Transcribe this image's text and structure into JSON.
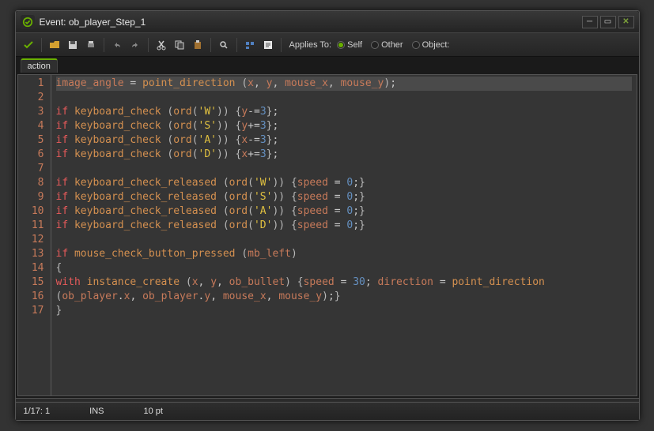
{
  "window": {
    "title": "Event: ob_player_Step_1"
  },
  "toolbar": {
    "applies_to_label": "Applies To:",
    "radios": {
      "self": "Self",
      "other": "Other",
      "object": "Object:"
    }
  },
  "tab": {
    "label": "action"
  },
  "code": {
    "lines": [
      {
        "n": 1,
        "tokens": [
          [
            "var",
            "image_angle"
          ],
          [
            "op",
            " = "
          ],
          [
            "fn",
            "point_direction"
          ],
          [
            "op",
            " "
          ],
          [
            "paren",
            "("
          ],
          [
            "var",
            "x"
          ],
          [
            "op",
            ", "
          ],
          [
            "var",
            "y"
          ],
          [
            "op",
            ", "
          ],
          [
            "var",
            "mouse_x"
          ],
          [
            "op",
            ", "
          ],
          [
            "var",
            "mouse_y"
          ],
          [
            "paren",
            ")"
          ],
          [
            "op",
            ";"
          ]
        ],
        "hl": true
      },
      {
        "n": 2,
        "tokens": []
      },
      {
        "n": 3,
        "tokens": [
          [
            "kw",
            "if"
          ],
          [
            "op",
            " "
          ],
          [
            "fn",
            "keyboard_check"
          ],
          [
            "op",
            " "
          ],
          [
            "paren",
            "("
          ],
          [
            "fn",
            "ord"
          ],
          [
            "paren",
            "("
          ],
          [
            "str",
            "'W'"
          ],
          [
            "paren",
            ")"
          ],
          [
            "paren",
            ")"
          ],
          [
            "op",
            " "
          ],
          [
            "paren",
            "{"
          ],
          [
            "var",
            "y"
          ],
          [
            "op",
            "-="
          ],
          [
            "num",
            "3"
          ],
          [
            "paren",
            "}"
          ],
          [
            "op",
            ";"
          ]
        ]
      },
      {
        "n": 4,
        "tokens": [
          [
            "kw",
            "if"
          ],
          [
            "op",
            " "
          ],
          [
            "fn",
            "keyboard_check"
          ],
          [
            "op",
            " "
          ],
          [
            "paren",
            "("
          ],
          [
            "fn",
            "ord"
          ],
          [
            "paren",
            "("
          ],
          [
            "str",
            "'S'"
          ],
          [
            "paren",
            ")"
          ],
          [
            "paren",
            ")"
          ],
          [
            "op",
            " "
          ],
          [
            "paren",
            "{"
          ],
          [
            "var",
            "y"
          ],
          [
            "op",
            "+="
          ],
          [
            "num",
            "3"
          ],
          [
            "paren",
            "}"
          ],
          [
            "op",
            ";"
          ]
        ]
      },
      {
        "n": 5,
        "tokens": [
          [
            "kw",
            "if"
          ],
          [
            "op",
            " "
          ],
          [
            "fn",
            "keyboard_check"
          ],
          [
            "op",
            " "
          ],
          [
            "paren",
            "("
          ],
          [
            "fn",
            "ord"
          ],
          [
            "paren",
            "("
          ],
          [
            "str",
            "'A'"
          ],
          [
            "paren",
            ")"
          ],
          [
            "paren",
            ")"
          ],
          [
            "op",
            " "
          ],
          [
            "paren",
            "{"
          ],
          [
            "var",
            "x"
          ],
          [
            "op",
            "-="
          ],
          [
            "num",
            "3"
          ],
          [
            "paren",
            "}"
          ],
          [
            "op",
            ";"
          ]
        ]
      },
      {
        "n": 6,
        "tokens": [
          [
            "kw",
            "if"
          ],
          [
            "op",
            " "
          ],
          [
            "fn",
            "keyboard_check"
          ],
          [
            "op",
            " "
          ],
          [
            "paren",
            "("
          ],
          [
            "fn",
            "ord"
          ],
          [
            "paren",
            "("
          ],
          [
            "str",
            "'D'"
          ],
          [
            "paren",
            ")"
          ],
          [
            "paren",
            ")"
          ],
          [
            "op",
            " "
          ],
          [
            "paren",
            "{"
          ],
          [
            "var",
            "x"
          ],
          [
            "op",
            "+="
          ],
          [
            "num",
            "3"
          ],
          [
            "paren",
            "}"
          ],
          [
            "op",
            ";"
          ]
        ]
      },
      {
        "n": 7,
        "tokens": []
      },
      {
        "n": 8,
        "tokens": [
          [
            "kw",
            "if"
          ],
          [
            "op",
            " "
          ],
          [
            "fn",
            "keyboard_check_released"
          ],
          [
            "op",
            " "
          ],
          [
            "paren",
            "("
          ],
          [
            "fn",
            "ord"
          ],
          [
            "paren",
            "("
          ],
          [
            "str",
            "'W'"
          ],
          [
            "paren",
            ")"
          ],
          [
            "paren",
            ")"
          ],
          [
            "op",
            " "
          ],
          [
            "paren",
            "{"
          ],
          [
            "var",
            "speed"
          ],
          [
            "op",
            " = "
          ],
          [
            "num",
            "0"
          ],
          [
            "op",
            ";"
          ],
          [
            "paren",
            "}"
          ]
        ]
      },
      {
        "n": 9,
        "tokens": [
          [
            "kw",
            "if"
          ],
          [
            "op",
            " "
          ],
          [
            "fn",
            "keyboard_check_released"
          ],
          [
            "op",
            " "
          ],
          [
            "paren",
            "("
          ],
          [
            "fn",
            "ord"
          ],
          [
            "paren",
            "("
          ],
          [
            "str",
            "'S'"
          ],
          [
            "paren",
            ")"
          ],
          [
            "paren",
            ")"
          ],
          [
            "op",
            " "
          ],
          [
            "paren",
            "{"
          ],
          [
            "var",
            "speed"
          ],
          [
            "op",
            " = "
          ],
          [
            "num",
            "0"
          ],
          [
            "op",
            ";"
          ],
          [
            "paren",
            "}"
          ]
        ]
      },
      {
        "n": 10,
        "tokens": [
          [
            "kw",
            "if"
          ],
          [
            "op",
            " "
          ],
          [
            "fn",
            "keyboard_check_released"
          ],
          [
            "op",
            " "
          ],
          [
            "paren",
            "("
          ],
          [
            "fn",
            "ord"
          ],
          [
            "paren",
            "("
          ],
          [
            "str",
            "'A'"
          ],
          [
            "paren",
            ")"
          ],
          [
            "paren",
            ")"
          ],
          [
            "op",
            " "
          ],
          [
            "paren",
            "{"
          ],
          [
            "var",
            "speed"
          ],
          [
            "op",
            " = "
          ],
          [
            "num",
            "0"
          ],
          [
            "op",
            ";"
          ],
          [
            "paren",
            "}"
          ]
        ]
      },
      {
        "n": 11,
        "tokens": [
          [
            "kw",
            "if"
          ],
          [
            "op",
            " "
          ],
          [
            "fn",
            "keyboard_check_released"
          ],
          [
            "op",
            " "
          ],
          [
            "paren",
            "("
          ],
          [
            "fn",
            "ord"
          ],
          [
            "paren",
            "("
          ],
          [
            "str",
            "'D'"
          ],
          [
            "paren",
            ")"
          ],
          [
            "paren",
            ")"
          ],
          [
            "op",
            " "
          ],
          [
            "paren",
            "{"
          ],
          [
            "var",
            "speed"
          ],
          [
            "op",
            " = "
          ],
          [
            "num",
            "0"
          ],
          [
            "op",
            ";"
          ],
          [
            "paren",
            "}"
          ]
        ]
      },
      {
        "n": 12,
        "tokens": []
      },
      {
        "n": 13,
        "tokens": [
          [
            "kw",
            "if"
          ],
          [
            "op",
            " "
          ],
          [
            "fn",
            "mouse_check_button_pressed"
          ],
          [
            "op",
            " "
          ],
          [
            "paren",
            "("
          ],
          [
            "var",
            "mb_left"
          ],
          [
            "paren",
            ")"
          ]
        ]
      },
      {
        "n": 14,
        "tokens": [
          [
            "paren",
            "{"
          ]
        ]
      },
      {
        "n": 15,
        "tokens": [
          [
            "kw",
            "with"
          ],
          [
            "op",
            " "
          ],
          [
            "fn",
            "instance_create"
          ],
          [
            "op",
            " "
          ],
          [
            "paren",
            "("
          ],
          [
            "var",
            "x"
          ],
          [
            "op",
            ", "
          ],
          [
            "var",
            "y"
          ],
          [
            "op",
            ", "
          ],
          [
            "var",
            "ob_bullet"
          ],
          [
            "paren",
            ")"
          ],
          [
            "op",
            " "
          ],
          [
            "paren",
            "{"
          ],
          [
            "var",
            "speed"
          ],
          [
            "op",
            " = "
          ],
          [
            "num",
            "30"
          ],
          [
            "op",
            "; "
          ],
          [
            "var",
            "direction"
          ],
          [
            "op",
            " = "
          ],
          [
            "fn",
            "point_direction"
          ]
        ]
      },
      {
        "n": 16,
        "tokens": [
          [
            "paren",
            "("
          ],
          [
            "var",
            "ob_player"
          ],
          [
            "op",
            "."
          ],
          [
            "var",
            "x"
          ],
          [
            "op",
            ", "
          ],
          [
            "var",
            "ob_player"
          ],
          [
            "op",
            "."
          ],
          [
            "var",
            "y"
          ],
          [
            "op",
            ", "
          ],
          [
            "var",
            "mouse_x"
          ],
          [
            "op",
            ", "
          ],
          [
            "var",
            "mouse_y"
          ],
          [
            "paren",
            ")"
          ],
          [
            "op",
            ";"
          ],
          [
            "paren",
            "}"
          ]
        ]
      },
      {
        "n": 17,
        "tokens": [
          [
            "paren",
            "}"
          ]
        ]
      }
    ]
  },
  "statusbar": {
    "position": "1/17:  1",
    "mode": "INS",
    "font": "10 pt"
  }
}
